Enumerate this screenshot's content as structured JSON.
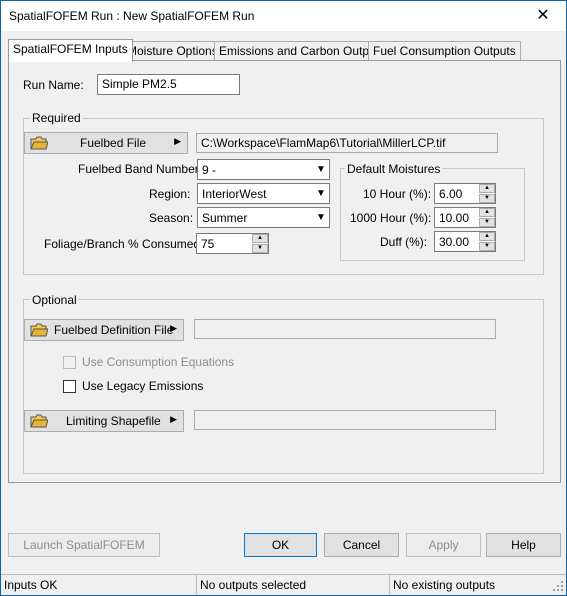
{
  "window": {
    "title": "SpatialFOFEM Run : New SpatialFOFEM Run",
    "close_glyph": "✕"
  },
  "tabs": [
    {
      "label": "SpatialFOFEM Inputs",
      "active": true
    },
    {
      "label": "Moisture Options",
      "active": false
    },
    {
      "label": "Emissions and Carbon Outputs",
      "active": false
    },
    {
      "label": "Fuel Consumption Outputs",
      "active": false
    }
  ],
  "run_name": {
    "label": "Run Name:",
    "value": "Simple PM2.5"
  },
  "required": {
    "title": "Required",
    "fuelbed_file": {
      "label": "Fuelbed File",
      "icon": "folder-icon",
      "path": "C:\\Workspace\\FlamMap6\\Tutorial\\MillerLCP.tif"
    },
    "band_number": {
      "label": "Fuelbed Band Number:",
      "value": "9 -"
    },
    "region": {
      "label": "Region:",
      "value": "InteriorWest"
    },
    "season": {
      "label": "Season:",
      "value": "Summer"
    },
    "foliage": {
      "label": "Foliage/Branch % Consumed:",
      "value": "75"
    },
    "moistures": {
      "title": "Default Moistures",
      "ten_hour": {
        "label": "10 Hour (%):",
        "value": "6.00"
      },
      "thousand_hour": {
        "label": "1000 Hour (%):",
        "value": "10.00"
      },
      "duff": {
        "label": "Duff (%):",
        "value": "30.00"
      }
    }
  },
  "optional": {
    "title": "Optional",
    "fuelbed_definition": {
      "label": "Fuelbed Definition File",
      "icon": "folder-icon",
      "path": ""
    },
    "use_consumption": {
      "label": "Use Consumption Equations",
      "checked": false,
      "enabled": false
    },
    "use_legacy": {
      "label": "Use Legacy Emissions",
      "checked": false,
      "enabled": true
    },
    "limiting_shapefile": {
      "label": "Limiting Shapefile",
      "icon": "folder-icon",
      "path": ""
    }
  },
  "buttons": {
    "launch": "Launch SpatialFOFEM",
    "ok": "OK",
    "cancel": "Cancel",
    "apply": "Apply",
    "help": "Help"
  },
  "status": [
    "Inputs OK",
    "No outputs selected",
    "No existing outputs"
  ],
  "colors": {
    "accent": "#0078d7",
    "window_border": "#0a64ad",
    "face": "#f0f0f0"
  }
}
